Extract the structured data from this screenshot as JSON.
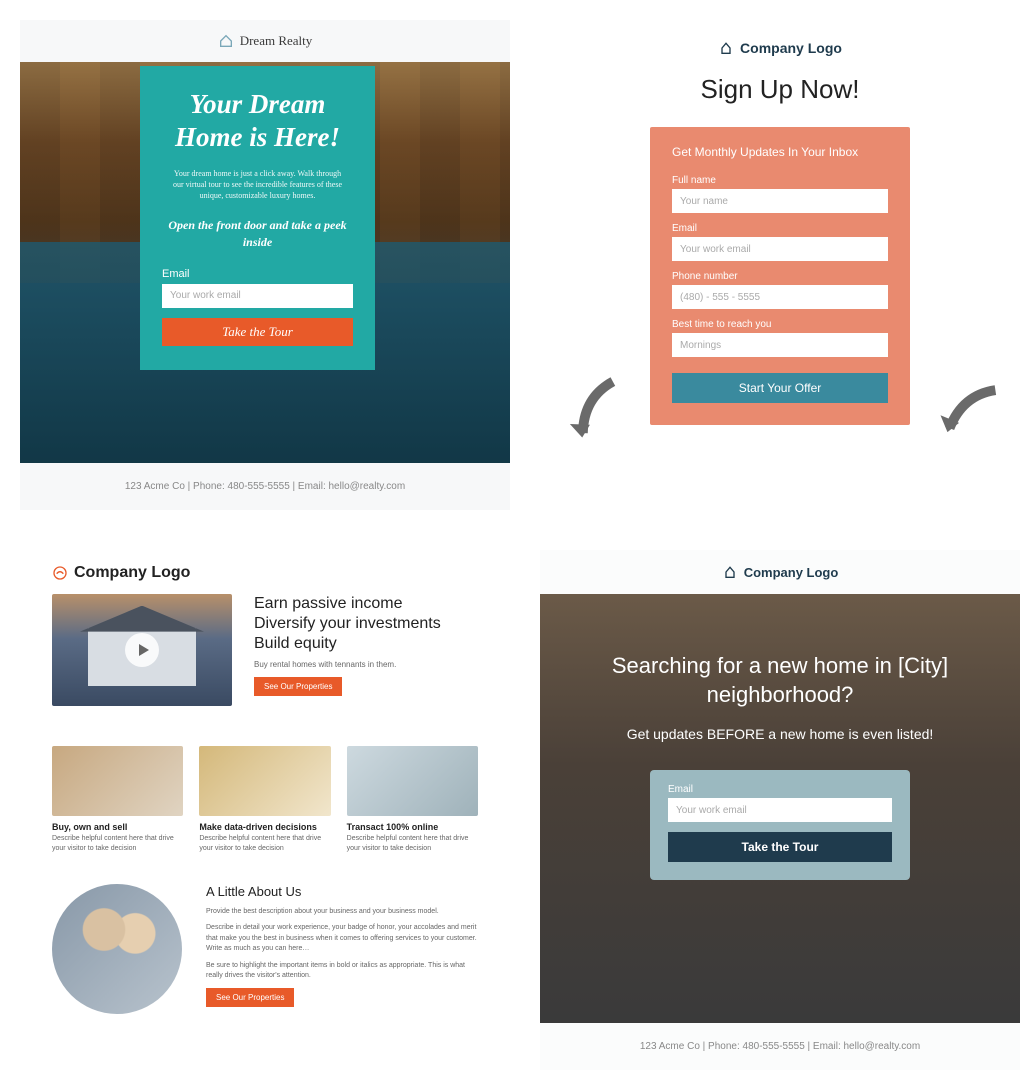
{
  "card1": {
    "brand": "Dream Realty",
    "title": "Your Dream Home is Here!",
    "desc": "Your dream home is just a click away. Walk through our virtual tour to see the incredible features of these unique, customizable luxury homes.",
    "subhead": "Open the front door and take a peek inside",
    "email_label": "Email",
    "email_placeholder": "Your work email",
    "cta": "Take the Tour",
    "footer": "123 Acme Co  |  Phone: 480-555-5555  |  Email: hello@realty.com"
  },
  "card2": {
    "brand": "Company Logo",
    "heading": "Sign Up Now!",
    "form_title": "Get Monthly Updates In Your Inbox",
    "fields": {
      "name_label": "Full name",
      "name_placeholder": "Your name",
      "email_label": "Email",
      "email_placeholder": "Your work email",
      "phone_label": "Phone number",
      "phone_placeholder": "(480) - 555 - 5555",
      "time_label": "Best time to reach you",
      "time_placeholder": "Mornings"
    },
    "cta": "Start Your Offer"
  },
  "card3": {
    "brand": "Company Logo",
    "hero_line1": "Earn passive income",
    "hero_line2": "Diversify your investments",
    "hero_line3": "Build equity",
    "hero_sub": "Buy rental homes with tennants in them.",
    "hero_cta": "See Our Properties",
    "features": [
      {
        "title": "Buy, own and sell",
        "body": "Describe helpful content here that drive your visitor to take decision"
      },
      {
        "title": "Make data-driven decisions",
        "body": "Describe helpful content here that drive your visitor to take decision"
      },
      {
        "title": "Transact 100% online",
        "body": "Describe helpful content here that drive your visitor to take decision"
      }
    ],
    "about_title": "A Little About Us",
    "about_p1": "Provide the best description about your business and your business model.",
    "about_p2": "Describe in detail your work experience, your badge of honor, your accolades and merit that make you the best in business when it comes to offering services to your customer. Write as much as you can here…",
    "about_p3": "Be sure to highlight the important items in bold or italics as appropriate. This is what really drives the visitor's attention.",
    "about_cta": "See Our Properties"
  },
  "card4": {
    "brand": "Company Logo",
    "title": "Searching for a new home in [City] neighborhood?",
    "sub": "Get updates BEFORE a new home is even listed!",
    "email_label": "Email",
    "email_placeholder": "Your work email",
    "cta": "Take the Tour",
    "footer": "123 Acme Co | Phone: 480-555-5555 | Email: hello@realty.com"
  }
}
